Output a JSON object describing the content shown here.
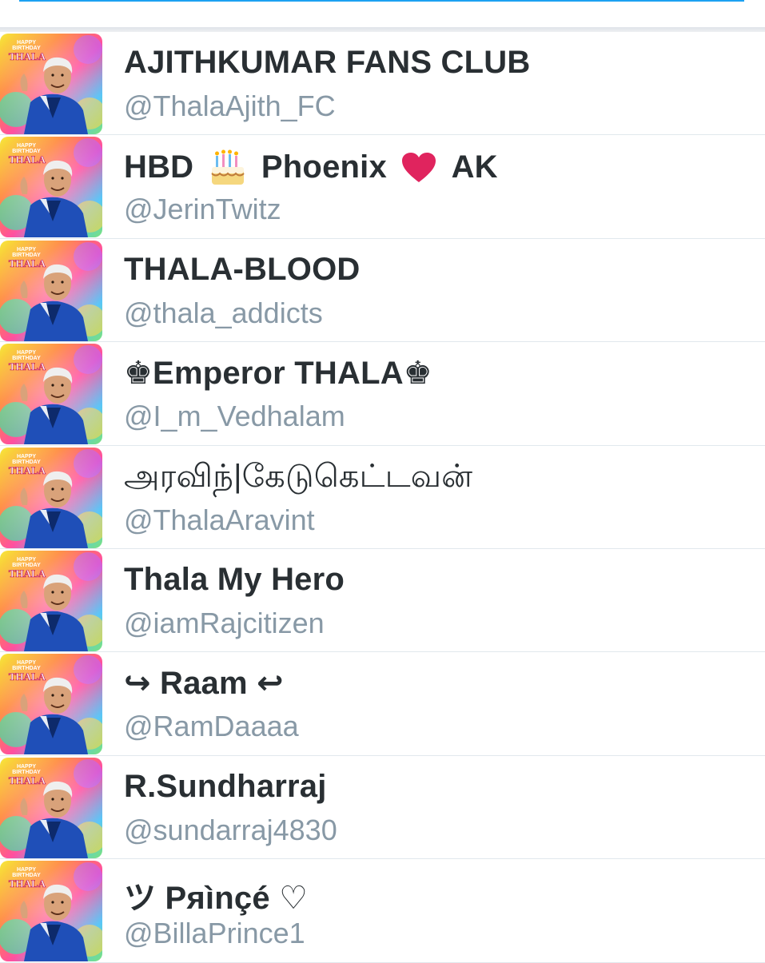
{
  "users": [
    {
      "name": "AJITHKUMAR FANS CLUB",
      "handle": "@ThalaAjith_FC"
    },
    {
      "name_parts": [
        "HBD",
        "Phoenix",
        "AK"
      ],
      "emojis": [
        "birthday-cake",
        "red-heart"
      ],
      "handle": "@JerinTwitz"
    },
    {
      "name": "THALA-BLOOD",
      "handle": "@thala_addicts"
    },
    {
      "name": "♚Emperor THALA♚",
      "handle": "@I_m_Vedhalam"
    },
    {
      "name": "அரவிந்|கேடுகெட்டவன்",
      "handle": "@ThalaAravint"
    },
    {
      "name": "Thala My Hero",
      "handle": "@iamRajcitizen"
    },
    {
      "name": "↪ Raam ↩",
      "handle": "@RamDaaaa"
    },
    {
      "name": "R.Sundharraj",
      "handle": "@sundarraj4830"
    },
    {
      "name": "ツ Pяìnçé ♡",
      "handle": "@BillaPrince1"
    }
  ],
  "avatar_text": {
    "line1": "HAPPY",
    "line2": "BIRTHDAY",
    "line3": "THALA"
  },
  "colors": {
    "accent": "#1da1f2",
    "name_text": "#292f33",
    "handle_text": "#8899a6",
    "divider": "#e1e8ed",
    "heart": "#e0245e"
  }
}
